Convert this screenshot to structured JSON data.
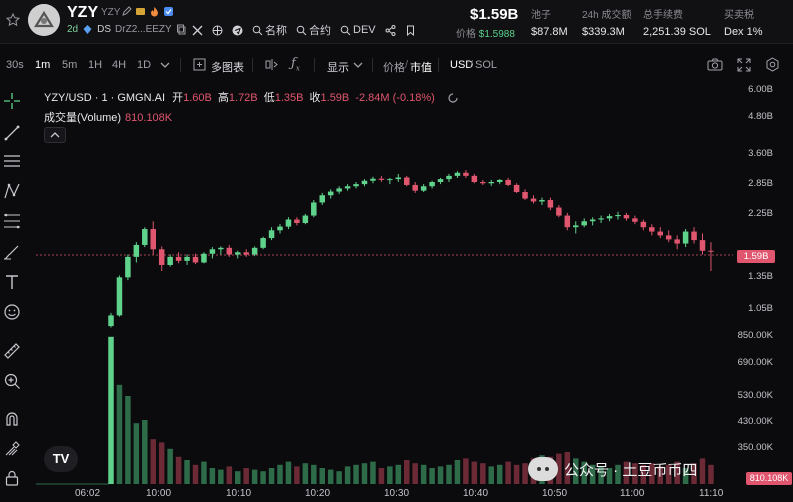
{
  "header": {
    "token_name": "YZY",
    "token_symbol": "YZY",
    "age": "2d",
    "ds_label": "DS",
    "address": "DrZ2...EEZY",
    "links": [
      "名称",
      "合约",
      "DEV"
    ],
    "price_main": "$1.59B",
    "price_prefix": "价格",
    "price_value": "$1.5988",
    "stats": [
      {
        "label": "池子",
        "value": "$87.8M"
      },
      {
        "label": "24h 成交额",
        "value": "$339.3M"
      },
      {
        "label": "总手续费",
        "value": "2,251.39 SOL"
      },
      {
        "label": "买卖税",
        "value": "Dex 1%"
      }
    ]
  },
  "toolbar": {
    "timeframes": [
      "30s",
      "1m",
      "5m",
      "1H",
      "4H",
      "1D"
    ],
    "selected": "1m",
    "multi_chart": "多图表",
    "display": "显示",
    "price_label": "价格",
    "mcap_label": "市值",
    "usd": "USD",
    "sol": "SOL"
  },
  "chart_data": {
    "type": "candlestick",
    "symbol": "YZY/USD · 1 · GMGN.AI",
    "ohlc_text": {
      "open_label": "开",
      "open": "1.60B",
      "high_label": "高",
      "high": "1.72B",
      "low_label": "低",
      "low": "1.35B",
      "close_label": "收",
      "close": "1.59B",
      "change": "-2.84M (-0.18%)"
    },
    "volume_label": "成交量(Volume)",
    "volume_value": "810.108K",
    "y_scale": "log",
    "y_ticks": [
      "6.00B",
      "4.80B",
      "3.60B",
      "2.85B",
      "2.25B",
      "1.35B",
      "1.05B",
      "850.00K",
      "690.00K",
      "530.00K",
      "430.00K",
      "350.00K"
    ],
    "y_tick_values": [
      6.0,
      4.8,
      3.6,
      2.85,
      2.25,
      1.35,
      1.05,
      0.85,
      0.69,
      0.53,
      0.43,
      0.35
    ],
    "x_ticks": [
      "06:02",
      "10:00",
      "10:10",
      "10:20",
      "10:30",
      "10:40",
      "10:50",
      "11:00",
      "11:10"
    ],
    "current_price_label": "1.59B",
    "current_volume_label": "810.108K",
    "candles": [
      [
        0.85,
        0.95,
        0.84,
        0.93
      ],
      [
        0.93,
        1.3,
        0.92,
        1.28
      ],
      [
        1.28,
        1.55,
        1.25,
        1.52
      ],
      [
        1.52,
        1.72,
        1.45,
        1.68
      ],
      [
        1.68,
        1.95,
        1.65,
        1.92
      ],
      [
        1.92,
        2.05,
        1.55,
        1.62
      ],
      [
        1.62,
        1.66,
        1.35,
        1.42
      ],
      [
        1.42,
        1.55,
        1.4,
        1.52
      ],
      [
        1.52,
        1.58,
        1.44,
        1.47
      ],
      [
        1.47,
        1.55,
        1.42,
        1.52
      ],
      [
        1.52,
        1.56,
        1.43,
        1.45
      ],
      [
        1.45,
        1.58,
        1.44,
        1.56
      ],
      [
        1.56,
        1.65,
        1.5,
        1.62
      ],
      [
        1.62,
        1.66,
        1.55,
        1.64
      ],
      [
        1.64,
        1.68,
        1.52,
        1.55
      ],
      [
        1.55,
        1.6,
        1.5,
        1.58
      ],
      [
        1.58,
        1.62,
        1.52,
        1.55
      ],
      [
        1.55,
        1.66,
        1.53,
        1.64
      ],
      [
        1.64,
        1.8,
        1.62,
        1.78
      ],
      [
        1.78,
        1.95,
        1.75,
        1.9
      ],
      [
        1.9,
        2.0,
        1.85,
        1.96
      ],
      [
        1.96,
        2.12,
        1.92,
        2.08
      ],
      [
        2.08,
        2.12,
        1.98,
        2.02
      ],
      [
        2.02,
        2.18,
        2.0,
        2.15
      ],
      [
        2.15,
        2.45,
        2.12,
        2.4
      ],
      [
        2.4,
        2.6,
        2.35,
        2.55
      ],
      [
        2.55,
        2.68,
        2.48,
        2.63
      ],
      [
        2.63,
        2.75,
        2.58,
        2.7
      ],
      [
        2.7,
        2.8,
        2.65,
        2.75
      ],
      [
        2.75,
        2.85,
        2.7,
        2.8
      ],
      [
        2.8,
        2.92,
        2.75,
        2.88
      ],
      [
        2.88,
        2.98,
        2.82,
        2.93
      ],
      [
        2.93,
        3.0,
        2.85,
        2.9
      ],
      [
        2.9,
        2.95,
        2.8,
        2.92
      ],
      [
        2.92,
        3.05,
        2.85,
        2.96
      ],
      [
        2.96,
        3.0,
        2.75,
        2.78
      ],
      [
        2.78,
        2.85,
        2.6,
        2.65
      ],
      [
        2.65,
        2.8,
        2.62,
        2.75
      ],
      [
        2.75,
        2.88,
        2.7,
        2.85
      ],
      [
        2.85,
        2.95,
        2.8,
        2.92
      ],
      [
        2.92,
        3.05,
        2.85,
        3.0
      ],
      [
        3.0,
        3.12,
        2.95,
        3.08
      ],
      [
        3.08,
        3.15,
        2.95,
        3.0
      ],
      [
        3.0,
        3.05,
        2.82,
        2.85
      ],
      [
        2.85,
        2.9,
        2.78,
        2.82
      ],
      [
        2.82,
        2.9,
        2.76,
        2.85
      ],
      [
        2.85,
        2.92,
        2.8,
        2.9
      ],
      [
        2.9,
        2.95,
        2.75,
        2.78
      ],
      [
        2.78,
        2.82,
        2.6,
        2.62
      ],
      [
        2.62,
        2.68,
        2.45,
        2.48
      ],
      [
        2.48,
        2.55,
        2.38,
        2.42
      ],
      [
        2.42,
        2.5,
        2.35,
        2.45
      ],
      [
        2.45,
        2.5,
        2.25,
        2.3
      ],
      [
        2.3,
        2.35,
        2.12,
        2.15
      ],
      [
        2.15,
        2.2,
        1.9,
        1.95
      ],
      [
        1.95,
        2.05,
        1.85,
        1.98
      ],
      [
        1.98,
        2.1,
        1.95,
        2.05
      ],
      [
        2.05,
        2.12,
        1.98,
        2.08
      ],
      [
        2.08,
        2.15,
        2.02,
        2.1
      ],
      [
        2.1,
        2.18,
        2.05,
        2.14
      ],
      [
        2.14,
        2.22,
        2.08,
        2.16
      ],
      [
        2.16,
        2.2,
        2.06,
        2.1
      ],
      [
        2.1,
        2.15,
        2.0,
        2.04
      ],
      [
        2.04,
        2.08,
        1.9,
        1.95
      ],
      [
        1.95,
        2.0,
        1.82,
        1.88
      ],
      [
        1.88,
        1.95,
        1.78,
        1.82
      ],
      [
        1.82,
        1.9,
        1.72,
        1.76
      ],
      [
        1.76,
        1.82,
        1.62,
        1.7
      ],
      [
        1.7,
        1.92,
        1.65,
        1.88
      ],
      [
        1.88,
        1.95,
        1.7,
        1.75
      ],
      [
        1.75,
        1.85,
        1.55,
        1.6
      ],
      [
        1.6,
        1.72,
        1.35,
        1.59
      ]
    ],
    "volume": [
      0.92,
      0.62,
      0.55,
      0.38,
      0.4,
      0.28,
      0.26,
      0.22,
      0.17,
      0.15,
      0.12,
      0.14,
      0.1,
      0.09,
      0.11,
      0.08,
      0.1,
      0.09,
      0.08,
      0.1,
      0.12,
      0.14,
      0.11,
      0.13,
      0.12,
      0.1,
      0.09,
      0.08,
      0.11,
      0.12,
      0.13,
      0.14,
      0.1,
      0.11,
      0.12,
      0.15,
      0.13,
      0.12,
      0.1,
      0.11,
      0.12,
      0.15,
      0.16,
      0.14,
      0.13,
      0.11,
      0.12,
      0.14,
      0.12,
      0.13,
      0.16,
      0.18,
      0.17,
      0.19,
      0.2,
      0.16,
      0.14,
      0.12,
      0.11,
      0.1,
      0.12,
      0.14,
      0.13,
      0.12,
      0.13,
      0.11,
      0.12,
      0.14,
      0.1,
      0.13,
      0.16,
      0.12
    ],
    "colors": {
      "up": "#5fd38c",
      "down": "#e0566e",
      "up_vol": "#2e6b49",
      "down_vol": "#6b2a36"
    }
  },
  "watermark": "公众号 · 土豆币币四",
  "tv_logo": "TV"
}
